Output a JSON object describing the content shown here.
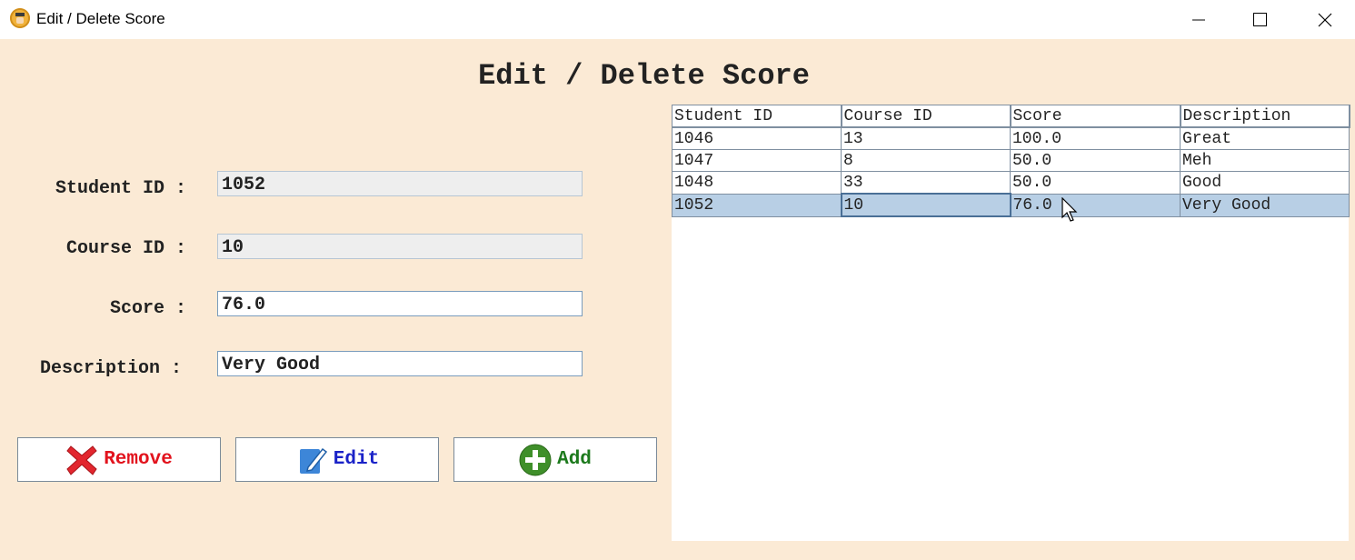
{
  "window": {
    "title": "Edit / Delete Score"
  },
  "page": {
    "heading": "Edit / Delete Score"
  },
  "form": {
    "student_id_label": "Student ID :",
    "student_id_value": "1052",
    "course_id_label": "Course ID :",
    "course_id_value": "10",
    "score_label": "Score :",
    "score_value": "76.0",
    "description_label": "Description :",
    "description_value": "Very Good"
  },
  "buttons": {
    "remove": "Remove",
    "edit": "Edit",
    "add": "Add"
  },
  "colors": {
    "background": "#fbead5",
    "remove": "#e2131d",
    "edit": "#1a22c8",
    "add": "#1d7a1d",
    "selected_row": "#b8cfe5"
  },
  "table": {
    "columns": [
      "Student ID",
      "Course ID",
      "Score",
      "Description"
    ],
    "rows": [
      [
        "1046",
        "13",
        "100.0",
        "Great"
      ],
      [
        "1047",
        "8",
        "50.0",
        "Meh"
      ],
      [
        "1048",
        "33",
        "50.0",
        "Good"
      ],
      [
        "1052",
        "10",
        "76.0",
        "Very Good"
      ]
    ],
    "selected_row": 3
  }
}
